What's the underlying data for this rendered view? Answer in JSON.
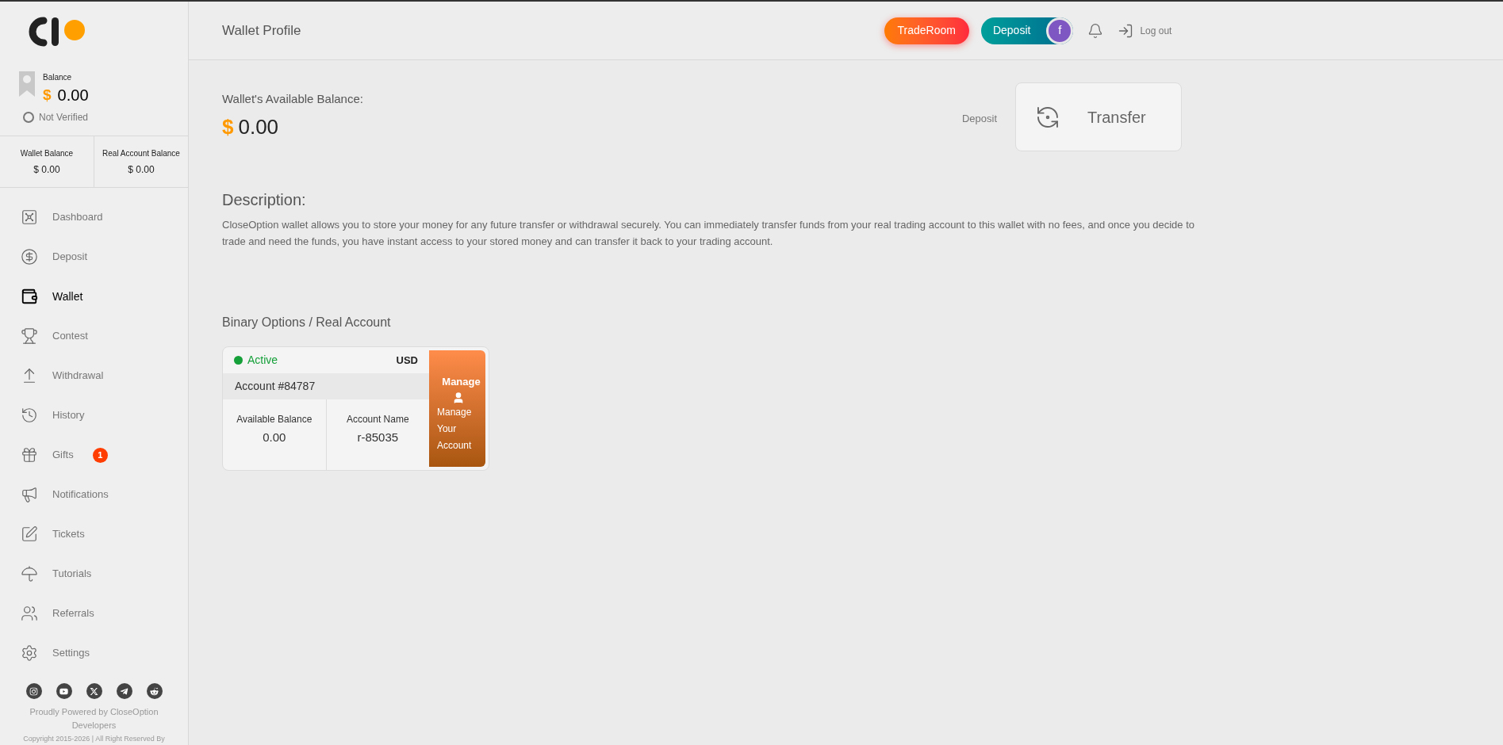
{
  "sidebar": {
    "balance": {
      "label": "Balance",
      "currency": "$",
      "amount": "0.00",
      "verification": "Not Verified",
      "verified": false
    },
    "balances": [
      {
        "label": "Wallet Balance",
        "value": "$ 0.00"
      },
      {
        "label": "Real Account Balance",
        "value": "$ 0.00"
      }
    ],
    "items": [
      {
        "label": "Dashboard",
        "selected": false
      },
      {
        "label": "Deposit",
        "selected": false
      },
      {
        "label": "Wallet",
        "selected": true
      },
      {
        "label": "Contest",
        "selected": false
      },
      {
        "label": "Withdrawal",
        "selected": false
      },
      {
        "label": "History",
        "selected": false
      },
      {
        "label": "Gifts",
        "selected": false,
        "badge": "1"
      },
      {
        "label": "Notifications",
        "selected": false
      },
      {
        "label": "Tickets",
        "selected": false
      },
      {
        "label": "Tutorials",
        "selected": false
      },
      {
        "label": "Referrals",
        "selected": false
      },
      {
        "label": "Settings",
        "selected": false
      }
    ],
    "footer": [
      "Proudly Powered by CloseOption Developers",
      "Copyright 2015-2026 | All Right Reserved By"
    ]
  },
  "header": {
    "title": "Wallet Profile",
    "traderoom": "TradeRoom",
    "deposit": "Deposit",
    "avatar": "f",
    "logout": "Log out"
  },
  "wallet": {
    "label": "Wallet's Available Balance:",
    "currency": "$",
    "amount": "0.00",
    "deposit_link": "Deposit",
    "transfer": "Transfer"
  },
  "description": {
    "title": "Description:",
    "text": "CloseOption wallet allows you to store your money for any future transfer or withdrawal securely. You can immediately transfer funds from your real trading account to this wallet with no fees, and once you decide to trade and need the funds, you have instant access to your stored money and can transfer it back to your trading account."
  },
  "accounts": {
    "title": "Binary Options / Real Account",
    "items": [
      {
        "status": "Active",
        "active": true,
        "currency": "USD",
        "account": "Account #84787",
        "balance_label": "Available Balance",
        "balance": "0.00",
        "name_label": "Account Name",
        "name": "r-85035",
        "manage_title": "Manage",
        "manage_text": "Manage Your Account"
      }
    ]
  }
}
